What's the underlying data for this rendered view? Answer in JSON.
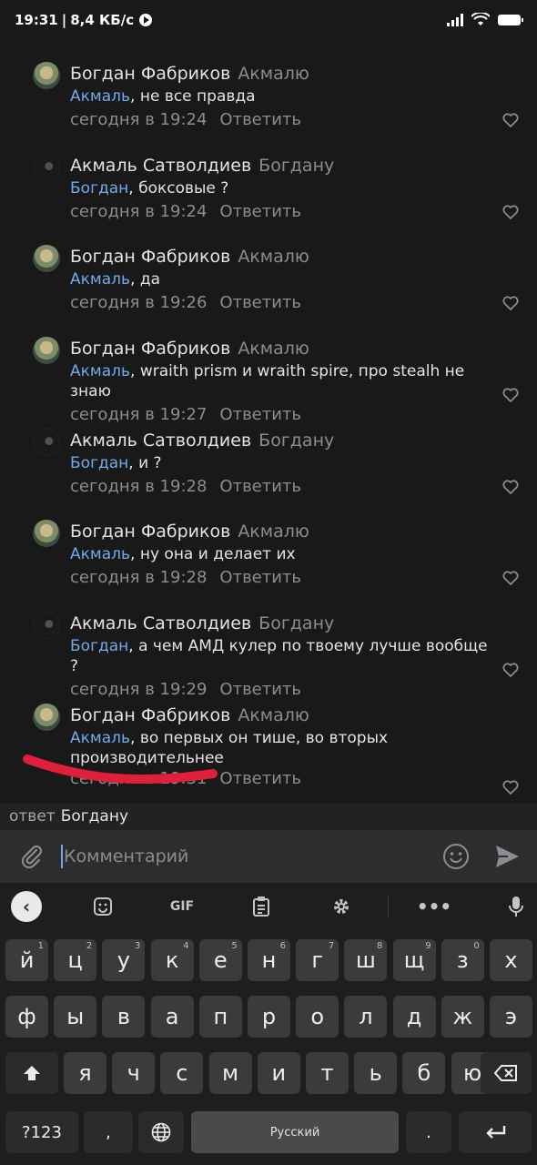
{
  "status_bar": {
    "time": "19:31",
    "speed": "8,4 КБ/с",
    "battery_icon": "battery-icon",
    "wifi_icon": "wifi-icon",
    "signal_icon": "signal-icon"
  },
  "comments": [
    {
      "author": "Богдан Фабриков",
      "reply_to": "Акмалю",
      "mention": "Акмаль",
      "text": ", не все правда",
      "time": "сегодня в 19:24",
      "reply_label": "Ответить",
      "avatar": "bogdan"
    },
    {
      "author": "Акмаль Сатволдиев",
      "reply_to": "Богдану",
      "mention": "Богдан",
      "text": ", боксовые ?",
      "time": "сегодня в 19:24",
      "reply_label": "Ответить",
      "avatar": "akmal"
    },
    {
      "author": "Богдан Фабриков",
      "reply_to": "Акмалю",
      "mention": "Акмаль",
      "text": ", да",
      "time": "сегодня в 19:26",
      "reply_label": "Ответить",
      "avatar": "bogdan"
    },
    {
      "author": "Богдан Фабриков",
      "reply_to": "Акмалю",
      "mention": "Акмаль",
      "text": ", wraith prism и wraith spire, про stealh не знаю",
      "time": "сегодня в 19:27",
      "reply_label": "Ответить",
      "avatar": "bogdan"
    },
    {
      "author": "Акмаль Сатволдиев",
      "reply_to": "Богдану",
      "mention": "Богдан",
      "text": ", и ?",
      "time": "сегодня в 19:28",
      "reply_label": "Ответить",
      "avatar": "akmal"
    },
    {
      "author": "Богдан Фабриков",
      "reply_to": "Акмалю",
      "mention": "Акмаль",
      "text": ", ну она и делает их",
      "time": "сегодня в 19:28",
      "reply_label": "Ответить",
      "avatar": "bogdan"
    },
    {
      "author": "Акмаль Сатволдиев",
      "reply_to": "Богдану",
      "mention": "Богдан",
      "text": ", а чем АМД кулер по твоему лучше вообще ?",
      "time": "сегодня в 19:29",
      "reply_label": "Ответить",
      "avatar": "akmal"
    },
    {
      "author": "Богдан Фабриков",
      "reply_to": "Акмалю",
      "mention": "Акмаль",
      "text": ", во первых он тише, во вторых производительнее",
      "time": "сегодня в 19:31",
      "reply_label": "Ответить",
      "avatar": "bogdan"
    }
  ],
  "reply_bar": {
    "prefix": "ответ",
    "name": "Богдану"
  },
  "composer": {
    "placeholder": "Комментарий"
  },
  "keyboard": {
    "toolbar_gif": "GIF",
    "row1": [
      [
        "й",
        "1"
      ],
      [
        "ц",
        "2"
      ],
      [
        "у",
        "3"
      ],
      [
        "к",
        "4"
      ],
      [
        "е",
        "5"
      ],
      [
        "н",
        "6"
      ],
      [
        "г",
        "7"
      ],
      [
        "ш",
        "8"
      ],
      [
        "щ",
        "9"
      ],
      [
        "з",
        "0"
      ],
      [
        "х",
        ""
      ]
    ],
    "row2": [
      "ф",
      "ы",
      "в",
      "а",
      "п",
      "р",
      "о",
      "л",
      "д",
      "ж",
      "э"
    ],
    "row3": [
      "я",
      "ч",
      "с",
      "м",
      "и",
      "т",
      "ь",
      "б",
      "ю"
    ],
    "numbers_key": "?123",
    "comma_key": ",",
    "space_label": "Русский",
    "period_key": "."
  },
  "colors": {
    "background": "#19191a",
    "mention": "#71aaeb",
    "scribble": "#e0203a"
  }
}
